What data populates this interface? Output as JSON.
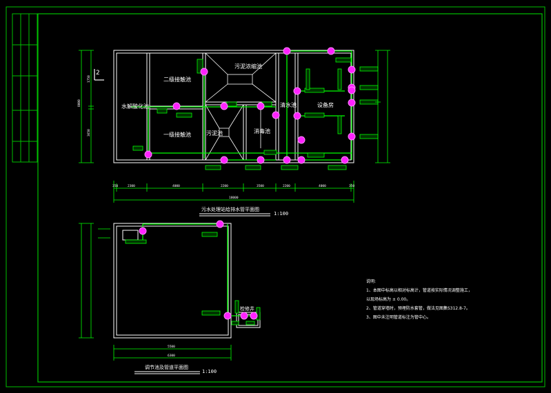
{
  "drawing": {
    "plan1": {
      "title": "污水处理站给排水管平面图",
      "scale": "1:100",
      "rooms": {
        "sludge_thickening": "污泥浓缩池",
        "secondary_a": "二级接触池",
        "secondary_b": "一级接触池",
        "hydrolysis": "水解酸化池",
        "clear_water": "清水池",
        "settling": "沉淀池",
        "equipment": "设备房",
        "sludge": "污泥池",
        "disinfect": "消毒池"
      },
      "section_mark": "2",
      "bottom_dims": [
        "350",
        "2300",
        "4000",
        "2200",
        "3500",
        "2200",
        "4000",
        "350"
      ],
      "total_dim": "18000",
      "left_dims": [
        "8000",
        "1750",
        "3650"
      ]
    },
    "plan2": {
      "title": "调节池及管道平面图",
      "scale": "1:100",
      "well_label": "检修井",
      "width_dim": "5500",
      "total_dim": "6300"
    },
    "notes": {
      "heading": "说明:",
      "items": [
        "1、本图中标高以相对标高计，管道按实际情况调整施工，",
        "    以现场标高为 ± 0.00。",
        "2、管道穿墙时，预埋防水套管，做法见图集S312.8-7。",
        "3、图中未注明管道标注为管中心。"
      ]
    }
  }
}
